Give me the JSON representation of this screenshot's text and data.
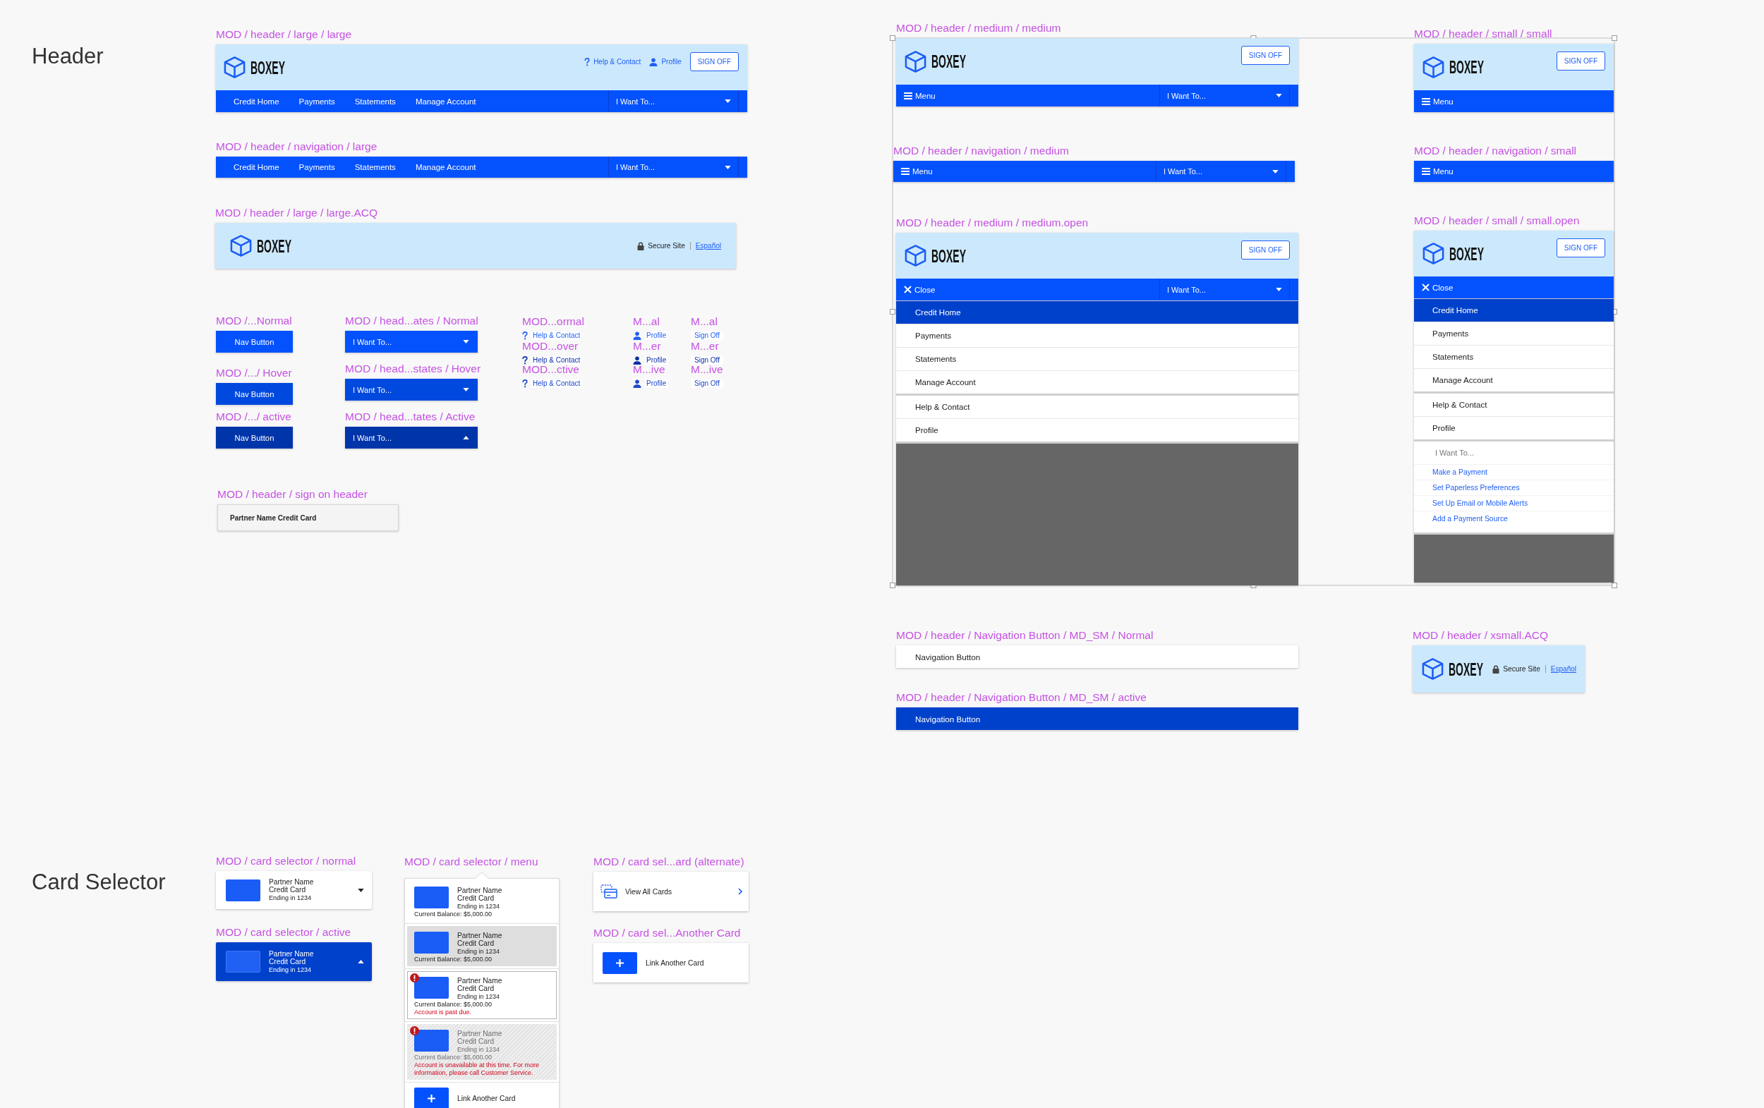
{
  "header_section": {
    "title": "Header",
    "frames": [
      {
        "label": "MOD / header / large / large",
        "kind": "header",
        "logo": "BOXEY",
        "links": [
          {
            "kind": "help",
            "text": "Help & Contact"
          },
          {
            "kind": "profile",
            "text": "Profile"
          }
        ],
        "sign_off": "SIGN OFF",
        "nav": {
          "items": [
            {
              "text": "Credit Home",
              "selected": false
            },
            {
              "text": "Payments",
              "selected": false
            },
            {
              "text": "Statements",
              "selected": false
            },
            {
              "text": "Manage Account",
              "selected": false
            }
          ],
          "dropdown": {
            "text": "I Want To...",
            "expanded": false
          }
        }
      },
      {
        "label": "MOD / header / navigation / large",
        "kind": "nav",
        "nav": {
          "items": [
            {
              "text": "Credit Home",
              "selected": false
            },
            {
              "text": "Payments",
              "selected": false
            },
            {
              "text": "Statements",
              "selected": false
            },
            {
              "text": "Manage Account",
              "selected": false
            }
          ],
          "dropdown": {
            "text": "I Want To...",
            "expanded": false
          }
        }
      },
      {
        "label": "MOD / header / large / large.ACQ",
        "kind": "header",
        "logo": "BOXEY",
        "secure": {
          "text": "Secure Site",
          "link": "Español"
        }
      },
      {
        "label": "MOD /...Normal",
        "kind": "nav_button",
        "text": "Nav Button",
        "hover": false,
        "active": false
      },
      {
        "label": "MOD /.../ Hover",
        "kind": "nav_button",
        "text": "Nav Button",
        "hover": true,
        "active": false
      },
      {
        "label": "MOD /.../ active",
        "kind": "nav_button",
        "text": "Nav Button",
        "hover": false,
        "active": true
      },
      {
        "label": "MOD / head...ates / Normal",
        "kind": "dropdown",
        "text": "I Want To...",
        "hover": false,
        "active": false,
        "expanded": false
      },
      {
        "label": "MOD / head...states / Hover",
        "kind": "dropdown",
        "text": "I Want To...",
        "hover": true,
        "active": false,
        "expanded": false
      },
      {
        "label": "MOD / head...tates / Active",
        "kind": "dropdown",
        "text": "I Want To...",
        "hover": false,
        "active": true,
        "expanded": true
      },
      {
        "label": "MOD...ormal",
        "kind": "help_link",
        "text": "Help & Contact",
        "hover": false,
        "active": false
      },
      {
        "label": "MOD...over",
        "kind": "help_link",
        "text": "Help & Contact",
        "hover": true,
        "active": false
      },
      {
        "label": "MOD...ctive",
        "kind": "help_link",
        "text": "Help & Contact",
        "hover": false,
        "active": true
      },
      {
        "label": "M...al",
        "kind": "profile_link",
        "text": "Profile",
        "hover": false,
        "active": false
      },
      {
        "label": "M...er",
        "kind": "profile_link",
        "text": "Profile",
        "hover": true,
        "active": false
      },
      {
        "label": "M...ive",
        "kind": "profile_link",
        "text": "Profile",
        "hover": false,
        "active": true
      },
      {
        "label": "M...al",
        "kind": "text_link",
        "text": "Sign Off",
        "hover": false,
        "active": false
      },
      {
        "label": "M...er",
        "kind": "text_link",
        "text": "Sign Off",
        "hover": true,
        "active": false
      },
      {
        "label": "M...ive",
        "kind": "text_link",
        "text": "Sign Off",
        "hover": false,
        "active": true
      },
      {
        "label": "MOD / header / sign on header",
        "kind": "sign_on",
        "text": "Partner Name Credit Card"
      },
      {
        "label": "MOD / header / medium / medium",
        "kind": "header",
        "logo": "BOXEY",
        "sign_off": "SIGN OFF",
        "nav": {
          "toggle": {
            "kind": "menu",
            "text": "Menu"
          },
          "dropdown": {
            "text": "I Want To...",
            "expanded": false
          }
        }
      },
      {
        "label": "MOD / header / navigation / medium",
        "kind": "nav",
        "nav": {
          "toggle": {
            "kind": "menu",
            "text": "Menu"
          },
          "dropdown": {
            "text": "I Want To...",
            "expanded": false
          }
        }
      },
      {
        "label": "MOD / header / medium / medium.open",
        "kind": "header",
        "logo": "BOXEY",
        "sign_off": "SIGN OFF",
        "nav": {
          "toggle": {
            "kind": "close",
            "text": "Close"
          },
          "dropdown": {
            "text": "I Want To...",
            "expanded": false
          }
        },
        "menu": {
          "groups": [
            {
              "items": [
                {
                  "text": "Credit Home",
                  "selected": true
                },
                {
                  "text": "Payments",
                  "selected": false
                },
                {
                  "text": "Statements",
                  "selected": false
                },
                {
                  "text": "Manage Account",
                  "selected": false
                }
              ]
            },
            {
              "items": [
                {
                  "text": "Help & Contact",
                  "selected": false
                },
                {
                  "text": "Profile",
                  "selected": false
                }
              ]
            }
          ]
        }
      },
      {
        "label": "MOD / header / small / small",
        "kind": "header",
        "logo": "BOXEY",
        "sign_off": "SIGN OFF",
        "nav": {
          "toggle": {
            "kind": "menu",
            "text": "Menu"
          }
        }
      },
      {
        "label": "MOD / header / navigation / small",
        "kind": "nav",
        "nav": {
          "toggle": {
            "kind": "menu",
            "text": "Menu"
          }
        }
      },
      {
        "label": "MOD / header / small / small.open",
        "kind": "header",
        "logo": "BOXEY",
        "sign_off": "SIGN OFF",
        "nav": {
          "toggle": {
            "kind": "close",
            "text": "Close"
          }
        },
        "menu": {
          "groups": [
            {
              "items": [
                {
                  "text": "Credit Home",
                  "selected": true
                },
                {
                  "text": "Payments",
                  "selected": false
                },
                {
                  "text": "Statements",
                  "selected": false
                },
                {
                  "text": "Manage Account",
                  "selected": false
                }
              ]
            },
            {
              "items": [
                {
                  "text": "Help & Contact",
                  "selected": false
                },
                {
                  "text": "Profile",
                  "selected": false
                }
              ]
            },
            {
              "heading": "I Want To...",
              "links": [
                "Make a Payment",
                "Set Paperless Preferences",
                "Set Up Email or Mobile Alerts",
                "Add a Payment Source"
              ]
            }
          ]
        }
      },
      {
        "label": "MOD / header / Navigation Button / MD_SM / Normal",
        "kind": "menu_button",
        "text": "Navigation Button",
        "active": false
      },
      {
        "label": "MOD / header / Navigation Button / MD_SM / active",
        "kind": "menu_button",
        "text": "Navigation Button",
        "active": true
      },
      {
        "label": "MOD / header / xsmall.ACQ",
        "kind": "header",
        "logo": "BOXEY",
        "secure": {
          "text": "Secure Site",
          "link": "Español"
        }
      }
    ]
  },
  "card_selector_section": {
    "title": "Card Selector",
    "frames": [
      {
        "label": "MOD / card selector / normal",
        "kind": "card_selector",
        "card": {
          "name": "Partner Name",
          "product": "Credit Card",
          "ending": "Ending in 1234"
        },
        "active": false,
        "expanded": false
      },
      {
        "label": "MOD / card selector / active",
        "kind": "card_selector",
        "card": {
          "name": "Partner Name",
          "product": "Credit Card",
          "ending": "Ending in 1234"
        },
        "active": true,
        "expanded": true
      },
      {
        "label": "MOD / card selector / menu",
        "kind": "card_menu",
        "items": [
          {
            "kind": "card",
            "name": "Partner Name",
            "product": "Credit Card",
            "ending": "Ending in 1234",
            "balance": "Current Balance: $5,000.00",
            "hover": false,
            "focused": false,
            "disabled": false,
            "alert": false
          },
          {
            "kind": "card",
            "name": "Partner Name",
            "product": "Credit Card",
            "ending": "Ending in 1234",
            "balance": "Current Balance: $5,000.00",
            "hover": true,
            "focused": false,
            "disabled": false,
            "alert": false
          },
          {
            "kind": "card",
            "name": "Partner Name",
            "product": "Credit Card",
            "ending": "Ending in 1234",
            "balance": "Current Balance: $5,000.00",
            "hover": false,
            "focused": true,
            "disabled": false,
            "alert": true,
            "message": "Account is past due."
          },
          {
            "kind": "card",
            "name": "Partner Name",
            "product": "Credit Card",
            "ending": "Ending in 1234",
            "balance": "Current Balance: $5,000.00",
            "hover": false,
            "focused": false,
            "disabled": true,
            "alert": true,
            "message": "Account is unavailable at this time. For more information, please call Customer Service."
          },
          {
            "kind": "link",
            "text": "Link Another Card"
          }
        ]
      },
      {
        "label": "MOD / card sel...ard (alternate)",
        "kind": "view_all",
        "text": "View All Cards"
      },
      {
        "label": "MOD / card sel...Another Card",
        "kind": "link_card",
        "text": "Link Another Card"
      }
    ]
  }
}
